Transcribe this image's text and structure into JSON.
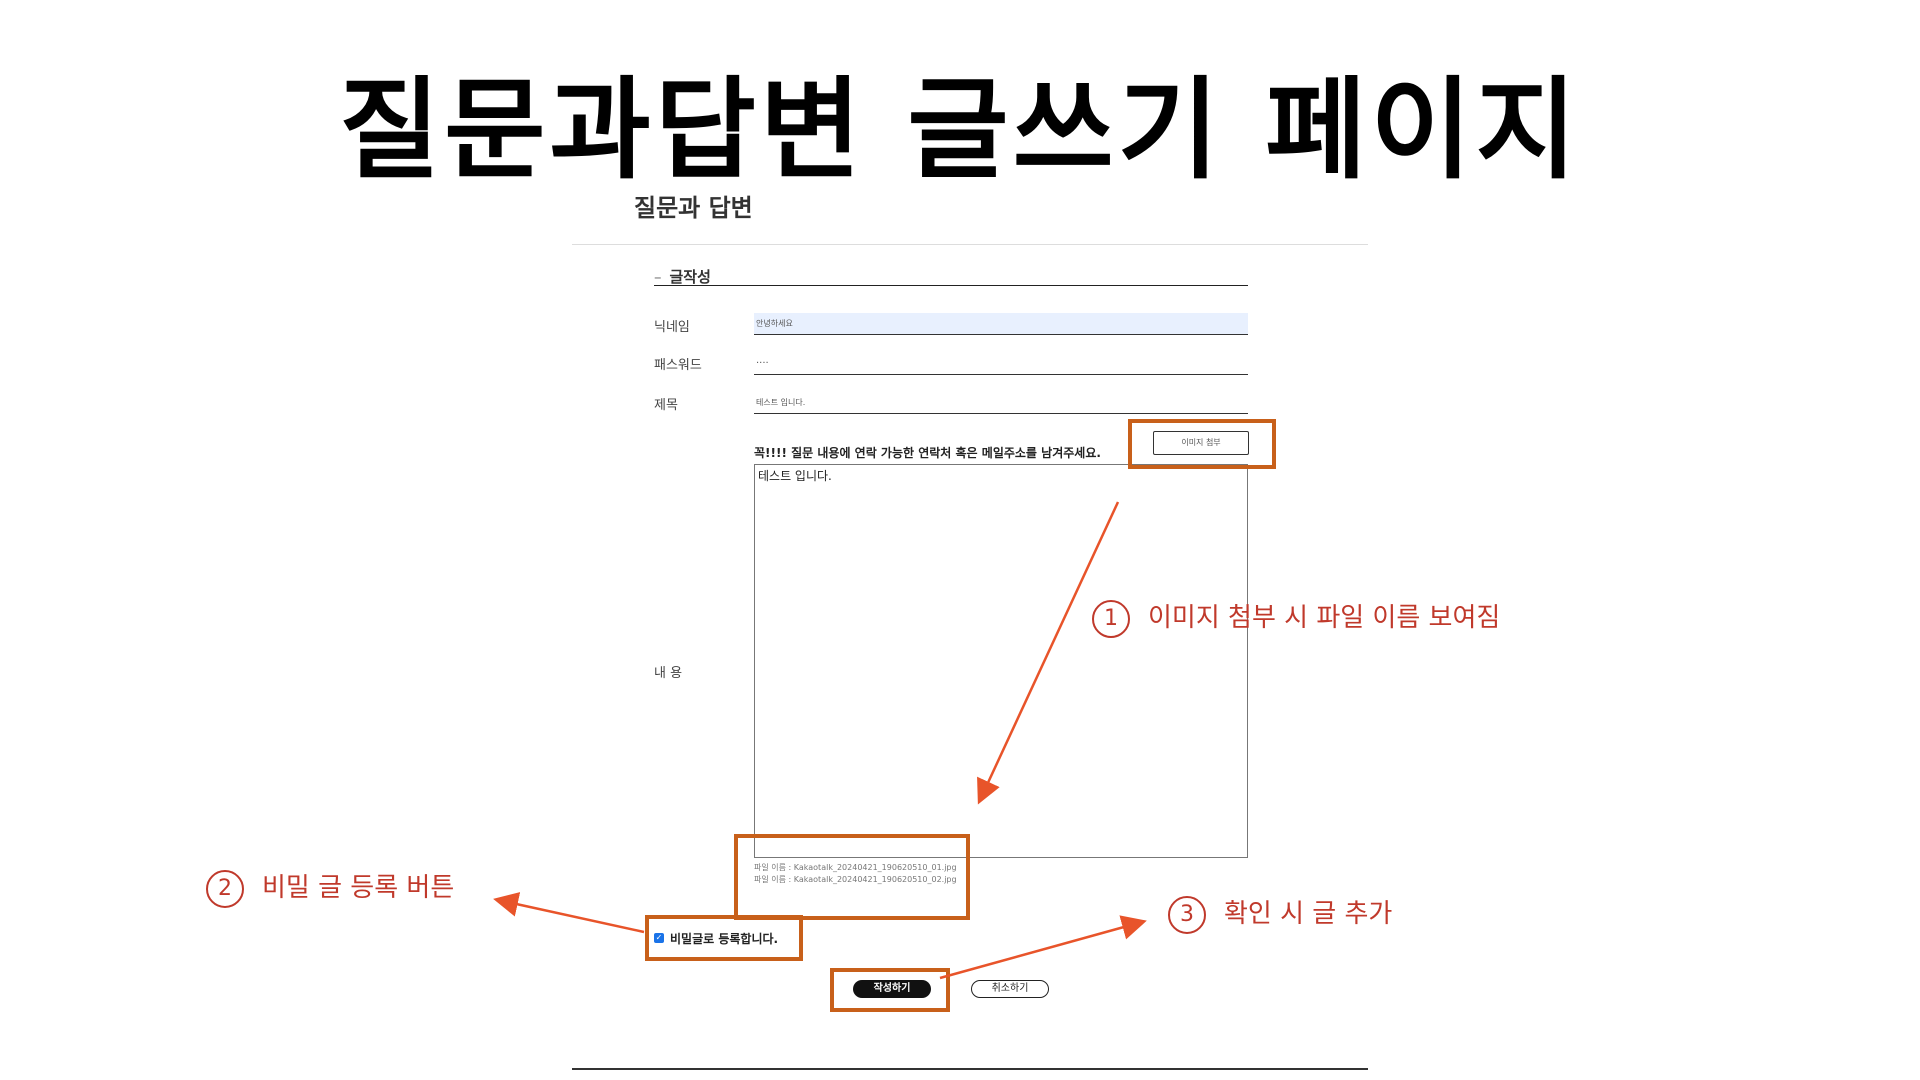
{
  "slide": {
    "title": "질문과답변 글쓰기 페이지"
  },
  "page": {
    "heading": "질문과 답변"
  },
  "form": {
    "section_dash": "–",
    "section_title": "글작성",
    "fields": [
      {
        "label": "닉네임",
        "value": "안녕하세요"
      },
      {
        "label": "패스워드",
        "value": "····"
      },
      {
        "label": "제목",
        "value": "테스트 입니다."
      }
    ],
    "content_label": "내 용",
    "notice": "꼭!!!! 질문 내용에 연락 가능한 연락처 혹은 메일주소를 남겨주세요.",
    "image_attach_button": "이미지 첨부",
    "content_value": "테스트 입니다.",
    "attached_files": [
      "파일 이름 : Kakaotalk_20240421_190620510_01.jpg",
      "파일 이름 : Kakaotalk_20240421_190620510_02.jpg"
    ],
    "secret_checkbox_checked": true,
    "secret_label": "비밀글로 등록합니다.",
    "submit_button": "작성하기",
    "cancel_button": "취소하기"
  },
  "annotations": [
    {
      "number": "1",
      "text": "이미지 첨부 시 파일 이름 보여짐"
    },
    {
      "number": "2",
      "text": "비밀 글 등록 버튼"
    },
    {
      "number": "3",
      "text": "확인 시 글 추가"
    }
  ],
  "colors": {
    "highlight": "#c8601a",
    "annotation": "#c0392b",
    "arrow": "#e8542a",
    "checkbox": "#1a73e8"
  }
}
